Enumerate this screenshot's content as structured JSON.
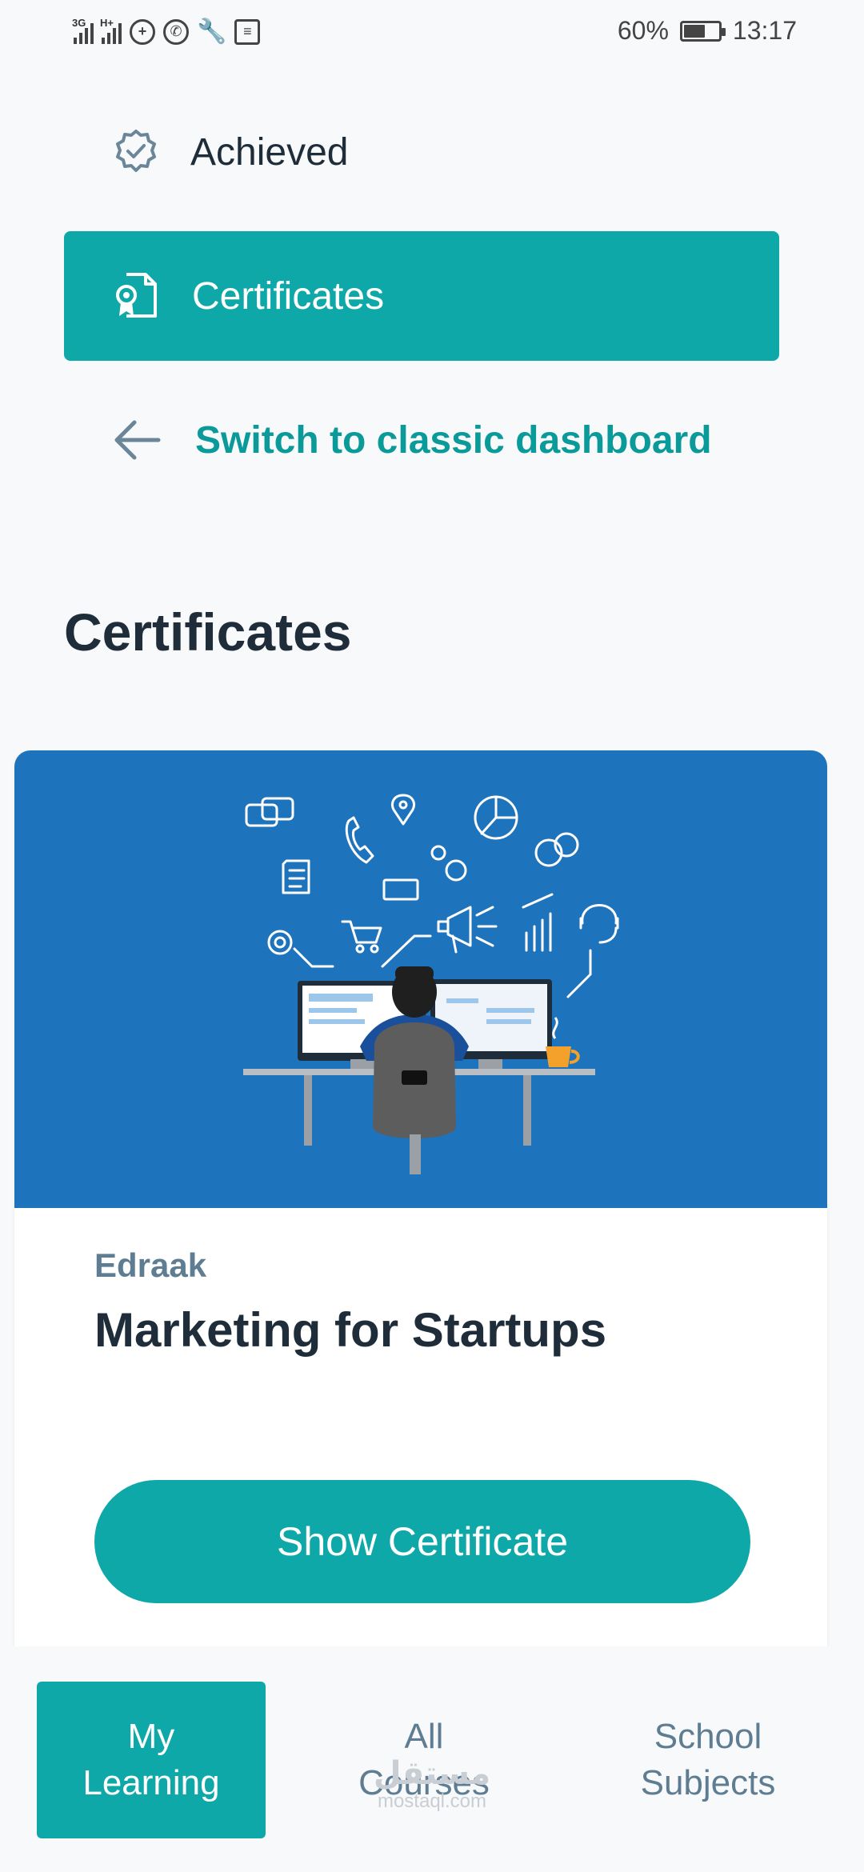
{
  "status_bar": {
    "network_1": "3G",
    "network_2": "H+",
    "battery_percent": "60%",
    "battery_level": 0.6,
    "time": "13:17"
  },
  "menu": {
    "achieved": {
      "label": "Achieved",
      "icon": "badge-check-icon"
    },
    "certificates": {
      "label": "Certificates",
      "icon": "certificate-icon"
    },
    "switch": {
      "label": "Switch to classic dashboard",
      "icon": "arrow-left-icon"
    }
  },
  "page": {
    "title": "Certificates"
  },
  "certificates": [
    {
      "provider": "Edraak",
      "course_title": "Marketing for Startups",
      "button_label": "Show Certificate"
    }
  ],
  "bottom_nav": {
    "items": [
      {
        "line1": "My",
        "line2": "Learning",
        "active": true
      },
      {
        "line1": "All",
        "line2": "Courses",
        "active": false
      },
      {
        "line1": "School",
        "line2": "Subjects",
        "active": false
      }
    ]
  },
  "watermark": {
    "arabic": "مستقل",
    "latin": "mostaql.com"
  },
  "colors": {
    "accent": "#0fa8a8",
    "card_image_bg": "#1e73bd",
    "text_dark": "#1f2d3a",
    "text_muted": "#5f7d92"
  }
}
